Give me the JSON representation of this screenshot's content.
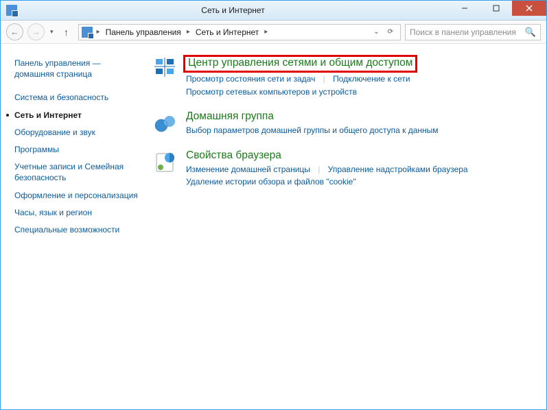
{
  "window": {
    "title": "Сеть и Интернет"
  },
  "breadcrumbs": {
    "item1": "Панель управления",
    "item2": "Сеть и Интернет"
  },
  "search": {
    "placeholder": "Поиск в панели управления"
  },
  "sidebar": {
    "home": "Панель управления — домашняя страница",
    "items": [
      {
        "label": "Система и безопасность"
      },
      {
        "label": "Сеть и Интернет"
      },
      {
        "label": "Оборудование и звук"
      },
      {
        "label": "Программы"
      },
      {
        "label": "Учетные записи и Семейная безопасность"
      },
      {
        "label": "Оформление и персонализация"
      },
      {
        "label": "Часы, язык и регион"
      },
      {
        "label": "Специальные возможности"
      }
    ]
  },
  "categories": [
    {
      "title": "Центр управления сетями и общим доступом",
      "links": [
        "Просмотр состояния сети и задач",
        "Подключение к сети",
        "Просмотр сетевых компьютеров и устройств"
      ]
    },
    {
      "title": "Домашняя группа",
      "links": [
        "Выбор параметров домашней группы и общего доступа к данным"
      ]
    },
    {
      "title": "Свойства браузера",
      "links": [
        "Изменение домашней страницы",
        "Управление надстройками браузера",
        "Удаление истории обзора и файлов \"cookie\""
      ]
    }
  ]
}
